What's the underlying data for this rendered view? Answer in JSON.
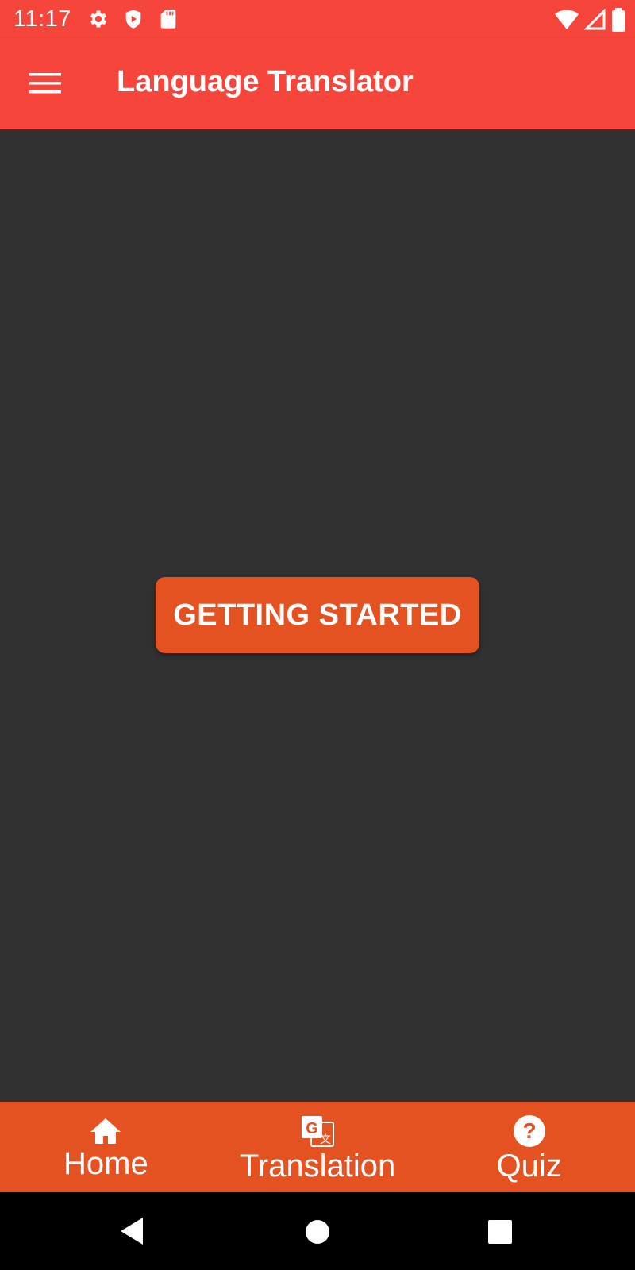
{
  "status_bar": {
    "time": "11:17",
    "left_icons": [
      "gear-icon",
      "shield-play-icon",
      "sd-card-icon"
    ],
    "right_icons": [
      "wifi-icon",
      "cell-signal-icon",
      "battery-icon"
    ]
  },
  "app_bar": {
    "menu_icon": "hamburger-menu-icon",
    "title": "Language Translator"
  },
  "main": {
    "cta_label": "GETTING STARTED"
  },
  "bottom_nav": {
    "items": [
      {
        "label": "Home",
        "icon": "home-icon"
      },
      {
        "label": "Translation",
        "icon": "translate-icon"
      },
      {
        "label": "Quiz",
        "icon": "help-circle-icon"
      }
    ]
  },
  "system_nav": {
    "buttons": [
      "back-icon",
      "home-circle-icon",
      "recents-icon"
    ]
  },
  "colors": {
    "app_bar": "#F6453A",
    "accent": "#E35220",
    "background": "#313131",
    "system_nav": "#000000",
    "text": "#FFFFFF"
  }
}
